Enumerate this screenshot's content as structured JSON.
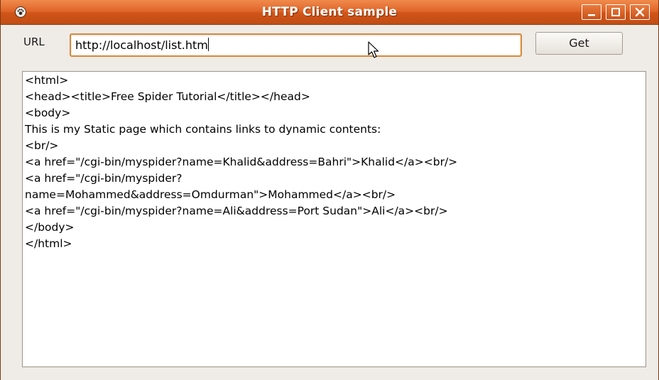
{
  "window": {
    "title": "HTTP Client sample",
    "controls": {
      "minimize": "minimize",
      "maximize": "maximize",
      "close": "close"
    }
  },
  "url_bar": {
    "label": "URL",
    "value": "http://localhost/list.htm",
    "button_label": "Get"
  },
  "response": {
    "lines": [
      "<html>",
      "<head><title>Free Spider Tutorial</title></head>",
      "<body>",
      "This is my Static page which contains links to dynamic contents:",
      "<br/>",
      "<a href=\"/cgi-bin/myspider?name=Khalid&address=Bahri\">Khalid</a><br/>",
      "<a href=\"/cgi-bin/myspider?",
      "name=Mohammed&address=Omdurman\">Mohammed</a><br/>",
      "<a href=\"/cgi-bin/myspider?name=Ali&address=Port Sudan\">Ali</a><br/>",
      "</body>",
      "</html>"
    ]
  },
  "colors": {
    "titlebar": "#d9602a",
    "input_border": "#d88a35",
    "window_bg": "#efebe7"
  }
}
